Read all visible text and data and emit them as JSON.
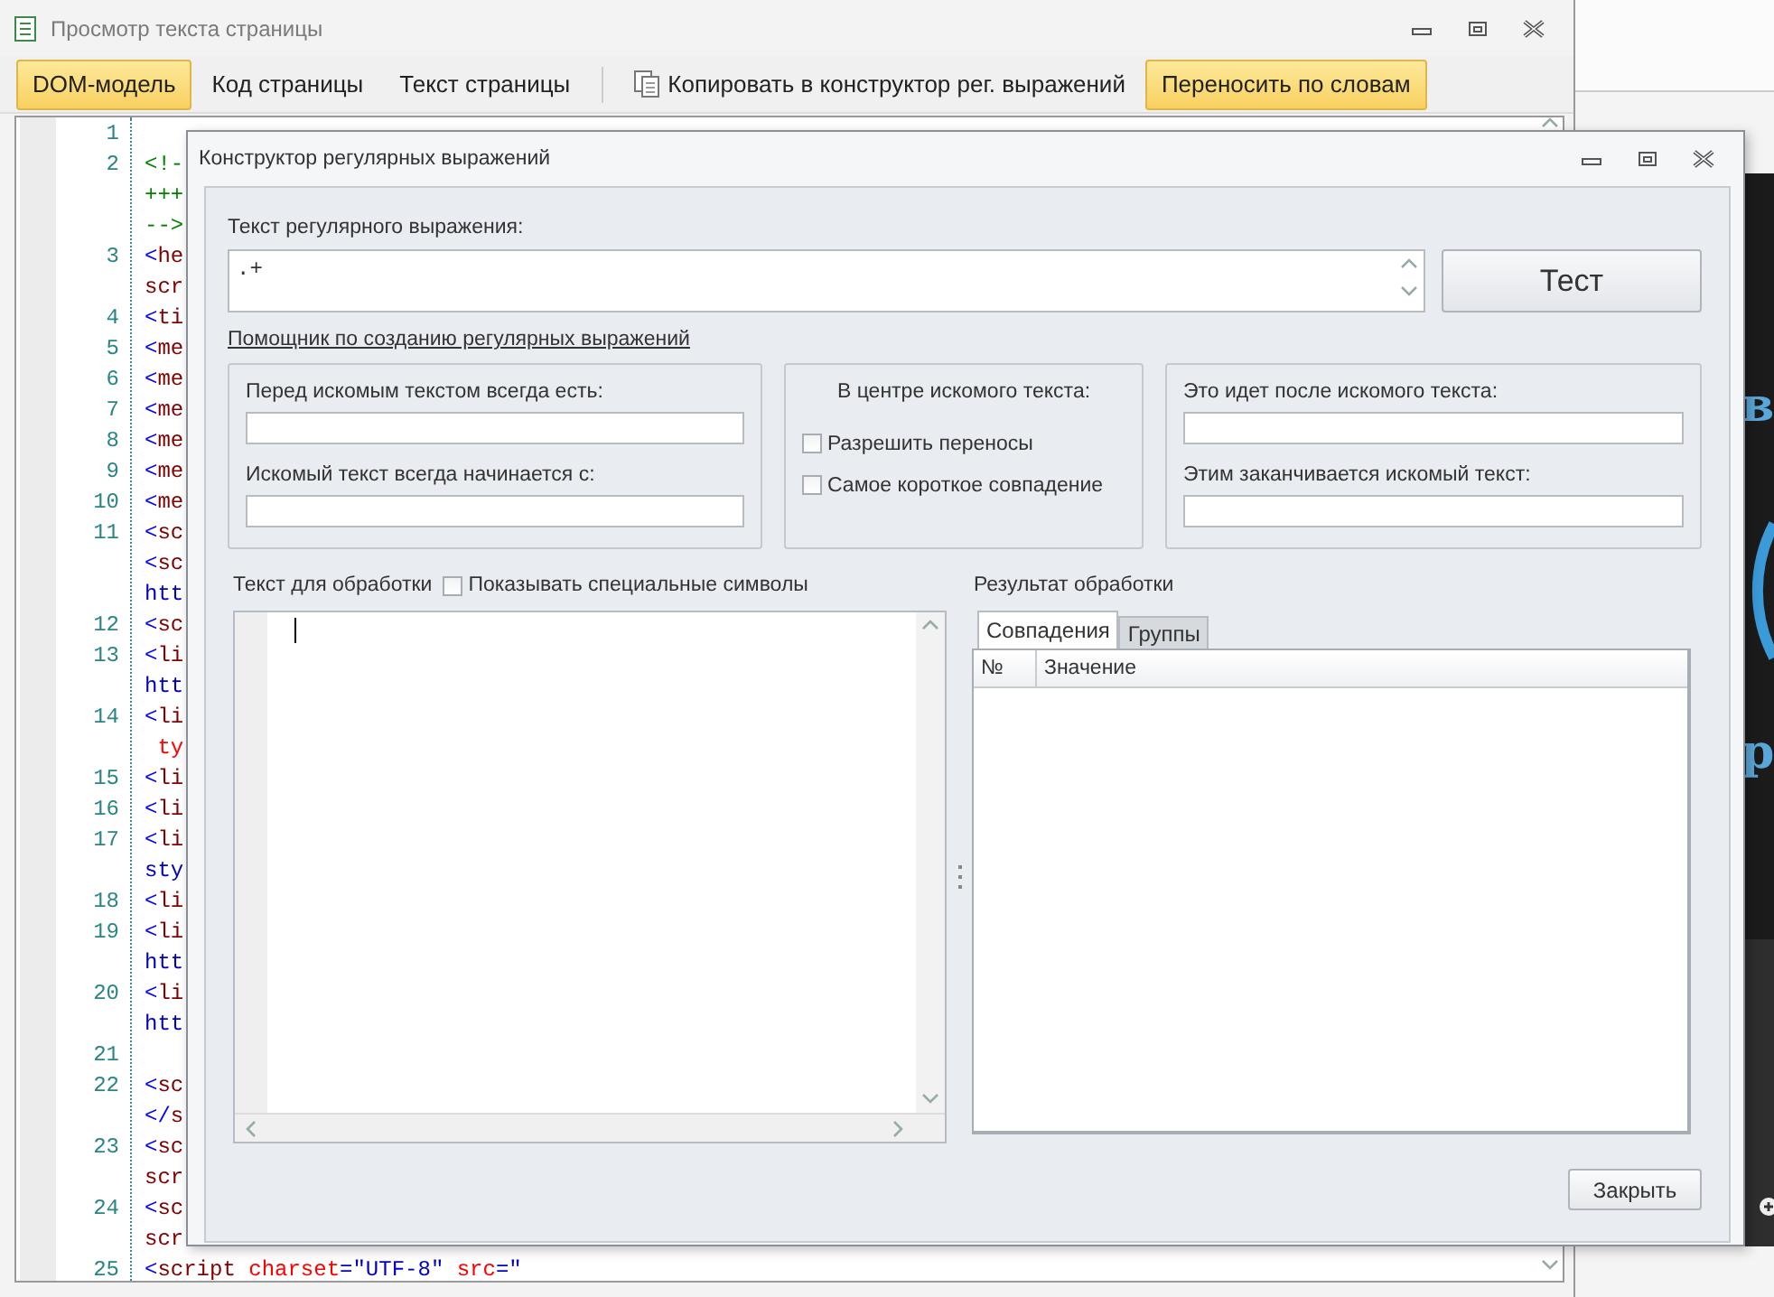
{
  "page_window": {
    "title": "Просмотр текста страницы",
    "toolbar": [
      {
        "kind": "view",
        "label": "DOM-модель",
        "selected": true
      },
      {
        "kind": "view",
        "label": "Код страницы",
        "selected": false
      },
      {
        "kind": "view",
        "label": "Текст страницы",
        "selected": false
      },
      {
        "kind": "action",
        "label": "Копировать в конструктор рег. выражений"
      },
      {
        "kind": "toggle",
        "label": "Переносить по словам",
        "on": true
      }
    ],
    "code_lines": [
      {
        "number": "1"
      },
      {
        "number": "2",
        "tokens": [
          {
            "kind": "comment",
            "text": "<!-"
          }
        ]
      },
      {
        "tokens": [
          {
            "kind": "comment",
            "text": "+++"
          }
        ]
      },
      {
        "tokens": [
          {
            "kind": "comment",
            "text": "-->"
          }
        ]
      },
      {
        "number": "3",
        "tokens": [
          {
            "kind": "bracket",
            "text": "<"
          },
          {
            "kind": "tag",
            "text": "he"
          }
        ]
      },
      {
        "tokens": [
          {
            "kind": "tag",
            "text": "scr"
          }
        ]
      },
      {
        "number": "4",
        "tokens": [
          {
            "kind": "bracket",
            "text": "<"
          },
          {
            "kind": "tag",
            "text": "ti"
          }
        ]
      },
      {
        "number": "5",
        "tokens": [
          {
            "kind": "bracket",
            "text": "<"
          },
          {
            "kind": "tag",
            "text": "me"
          }
        ]
      },
      {
        "number": "6",
        "tokens": [
          {
            "kind": "bracket",
            "text": "<"
          },
          {
            "kind": "tag",
            "text": "me"
          }
        ]
      },
      {
        "number": "7",
        "tokens": [
          {
            "kind": "bracket",
            "text": "<"
          },
          {
            "kind": "tag",
            "text": "me"
          }
        ]
      },
      {
        "number": "8",
        "tokens": [
          {
            "kind": "bracket",
            "text": "<"
          },
          {
            "kind": "tag",
            "text": "me"
          }
        ]
      },
      {
        "number": "9",
        "tokens": [
          {
            "kind": "bracket",
            "text": "<"
          },
          {
            "kind": "tag",
            "text": "me"
          }
        ]
      },
      {
        "number": "10",
        "tokens": [
          {
            "kind": "bracket",
            "text": "<"
          },
          {
            "kind": "tag",
            "text": "me"
          }
        ]
      },
      {
        "number": "11",
        "tokens": [
          {
            "kind": "bracket",
            "text": "<"
          },
          {
            "kind": "tag",
            "text": "sc"
          }
        ]
      },
      {
        "tokens": [
          {
            "kind": "bracket",
            "text": "<"
          },
          {
            "kind": "tag",
            "text": "sc"
          }
        ]
      },
      {
        "tokens": [
          {
            "kind": "value",
            "text": "htt"
          }
        ]
      },
      {
        "number": "12",
        "tokens": [
          {
            "kind": "bracket",
            "text": "<"
          },
          {
            "kind": "tag",
            "text": "sc"
          }
        ]
      },
      {
        "number": "13",
        "tokens": [
          {
            "kind": "bracket",
            "text": "<"
          },
          {
            "kind": "tag",
            "text": "li"
          }
        ]
      },
      {
        "tokens": [
          {
            "kind": "value",
            "text": "htt"
          }
        ]
      },
      {
        "number": "14",
        "tokens": [
          {
            "kind": "bracket",
            "text": "<"
          },
          {
            "kind": "tag",
            "text": "li"
          }
        ]
      },
      {
        "tokens": [
          {
            "kind": "attr",
            "text": " ty"
          }
        ]
      },
      {
        "number": "15",
        "tokens": [
          {
            "kind": "bracket",
            "text": "<"
          },
          {
            "kind": "tag",
            "text": "li"
          }
        ]
      },
      {
        "number": "16",
        "tokens": [
          {
            "kind": "bracket",
            "text": "<"
          },
          {
            "kind": "tag",
            "text": "li"
          }
        ]
      },
      {
        "number": "17",
        "tokens": [
          {
            "kind": "bracket",
            "text": "<"
          },
          {
            "kind": "tag",
            "text": "li"
          }
        ]
      },
      {
        "tokens": [
          {
            "kind": "value",
            "text": "sty"
          }
        ]
      },
      {
        "number": "18",
        "tokens": [
          {
            "kind": "bracket",
            "text": "<"
          },
          {
            "kind": "tag",
            "text": "li"
          }
        ]
      },
      {
        "number": "19",
        "tokens": [
          {
            "kind": "bracket",
            "text": "<"
          },
          {
            "kind": "tag",
            "text": "li"
          }
        ]
      },
      {
        "tokens": [
          {
            "kind": "value",
            "text": "htt"
          }
        ]
      },
      {
        "number": "20",
        "tokens": [
          {
            "kind": "bracket",
            "text": "<"
          },
          {
            "kind": "tag",
            "text": "li"
          }
        ]
      },
      {
        "tokens": [
          {
            "kind": "value",
            "text": "htt"
          }
        ]
      },
      {
        "number": "21"
      },
      {
        "number": "22",
        "tokens": [
          {
            "kind": "bracket",
            "text": "<"
          },
          {
            "kind": "tag",
            "text": "sc"
          }
        ]
      },
      {
        "tokens": [
          {
            "kind": "bracket",
            "text": "</"
          },
          {
            "kind": "tag",
            "text": "s"
          }
        ]
      },
      {
        "number": "23",
        "tokens": [
          {
            "kind": "bracket",
            "text": "<"
          },
          {
            "kind": "tag",
            "text": "sc"
          }
        ]
      },
      {
        "tokens": [
          {
            "kind": "tag",
            "text": "scr"
          }
        ]
      },
      {
        "number": "24",
        "tokens": [
          {
            "kind": "bracket",
            "text": "<"
          },
          {
            "kind": "tag",
            "text": "sc"
          }
        ]
      },
      {
        "tokens": [
          {
            "kind": "tag",
            "text": "scr"
          }
        ]
      },
      {
        "number": "25",
        "tokens": [
          {
            "kind": "bracket",
            "text": "<"
          },
          {
            "kind": "tag",
            "text": "script"
          },
          {
            "kind": "attr",
            "text": " charset"
          },
          {
            "kind": "value",
            "text": "=\"UTF-8\""
          },
          {
            "kind": "attr",
            "text": " src"
          },
          {
            "kind": "value",
            "text": "=\""
          }
        ]
      }
    ]
  },
  "regex_dialog": {
    "title": "Конструктор регулярных выражений",
    "expression_label": "Текст регулярного выражения:",
    "expression_value": ".+",
    "test_button": "Тест",
    "helper_link": "Помощник по созданию регулярных выражений",
    "groups": [
      {
        "kind": "fields",
        "fields": [
          "Перед искомым текстом всегда есть:",
          "Искомый текст всегда начинается с:"
        ]
      },
      {
        "kind": "options",
        "heading": "В центре искомого текста:",
        "options": [
          {
            "label": "Разрешить переносы",
            "checked": false
          },
          {
            "label": "Самое короткое совпадение",
            "checked": false
          }
        ]
      },
      {
        "kind": "fields",
        "fields": [
          "Это идет после искомого текста:",
          "Этим заканчивается искомый текст:"
        ]
      }
    ],
    "input_label": "Текст для обработки",
    "show_special": {
      "label": "Показывать специальные символы",
      "checked": false
    },
    "result_label": "Результат обработки",
    "result_tabs": [
      {
        "label": "Совпадения",
        "selected": true
      },
      {
        "label": "Группы",
        "selected": false
      }
    ],
    "columns": [
      "№",
      "Значение"
    ],
    "close_button": "Закрыть"
  },
  "browser_strip": {
    "fragments": [
      "в",
      "р"
    ]
  }
}
